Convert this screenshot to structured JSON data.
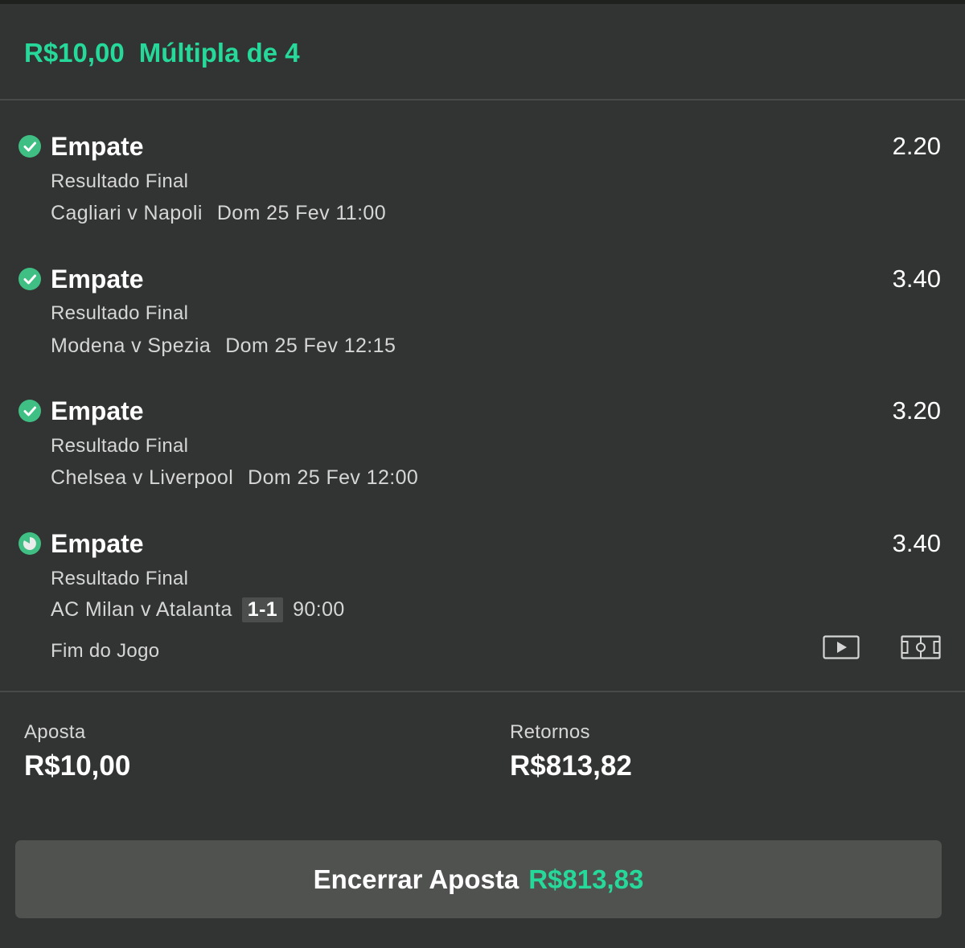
{
  "header": {
    "stake": "R$10,00",
    "bet_type": "Múltipla de 4"
  },
  "selections": [
    {
      "name": "Empate",
      "odds": "2.20",
      "market": "Resultado Final",
      "event": "Cagliari v Napoli",
      "time": "Dom 25 Fev 11:00",
      "status": "won",
      "icon": "check-circle-icon"
    },
    {
      "name": "Empate",
      "odds": "3.40",
      "market": "Resultado Final",
      "event": "Modena v Spezia",
      "time": "Dom 25 Fev 12:15",
      "status": "won",
      "icon": "check-circle-icon"
    },
    {
      "name": "Empate",
      "odds": "3.20",
      "market": "Resultado Final",
      "event": "Chelsea v Liverpool",
      "time": "Dom 25 Fev 12:00",
      "status": "won",
      "icon": "check-circle-icon"
    },
    {
      "name": "Empate",
      "odds": "3.40",
      "market": "Resultado Final",
      "event": "AC Milan v Atalanta",
      "score": "1-1",
      "clock": "90:00",
      "game_status": "Fim do Jogo",
      "status": "in-progress",
      "icon": "winning-progress-icon"
    }
  ],
  "summary": {
    "stake_label": "Aposta",
    "stake_value": "R$10,00",
    "returns_label": "Retornos",
    "returns_value": "R$813,82"
  },
  "cashout": {
    "label": "Encerrar Aposta",
    "amount": "R$813,83"
  },
  "icons": {
    "video": "video-play-icon",
    "pitch": "pitch-stats-icon"
  },
  "colors": {
    "accent": "#26d99a",
    "background": "#313432",
    "status_green": "#3fbf83",
    "button": "#505250"
  }
}
